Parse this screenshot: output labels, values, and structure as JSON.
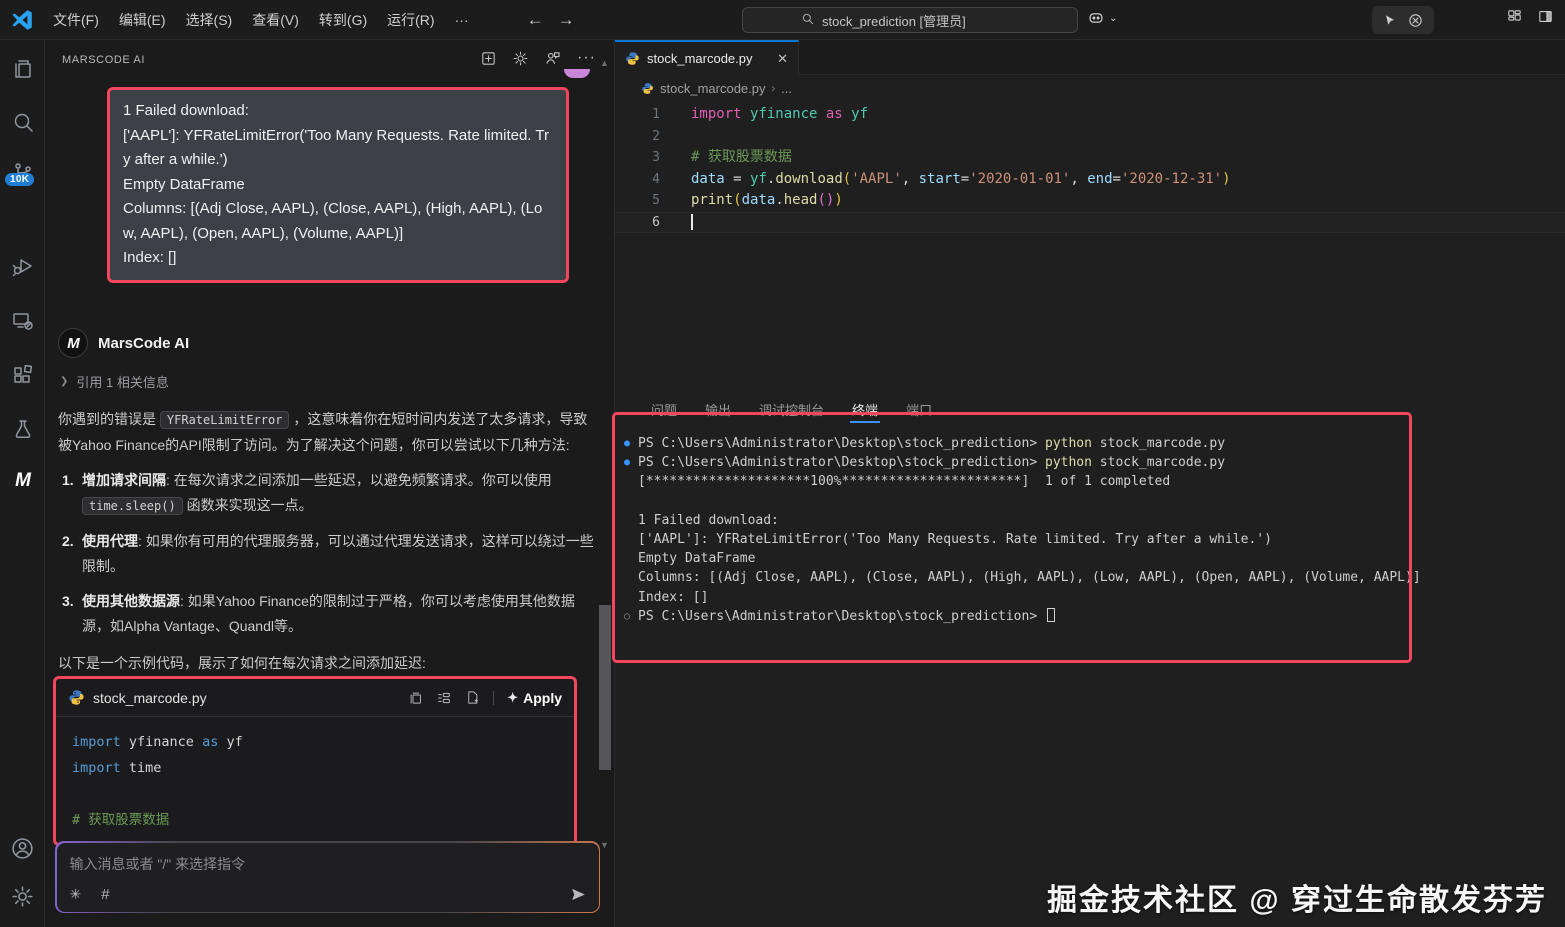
{
  "titlebar": {
    "menus": [
      "文件(F)",
      "编辑(E)",
      "选择(S)",
      "查看(V)",
      "转到(G)",
      "运行(R)"
    ],
    "more": "···",
    "search_text": "stock_prediction [管理员]"
  },
  "activitybar": {
    "scm_badge": "10K",
    "marscode_glyph": "M"
  },
  "sidebar": {
    "title": "MARSCODE AI",
    "tools_more": "···",
    "output_block": {
      "lines": [
        "1 Failed download:",
        "['AAPL']: YFRateLimitError('Too Many Requests. Rate limited. Try after a while.')",
        "Empty DataFrame",
        "Columns: [(Adj Close, AAPL), (Close, AAPL), (High, AAPL), (Low, AAPL), (Open, AAPL), (Volume, AAPL)]",
        "Index: []"
      ]
    },
    "assistant": {
      "name": "MarsCode AI",
      "logo_glyph": "M",
      "reference": "引用 1 相关信息",
      "para_pre": "你遇到的错误是 ",
      "para_code": "YFRateLimitError",
      "para_post": " ，这意味着你在短时间内发送了太多请求，导致被Yahoo Finance的API限制了访问。为了解决这个问题，你可以尝试以下几种方法:",
      "list": [
        {
          "num": "1.",
          "bold": "增加请求间隔",
          "pre": ": 在每次请求之间添加一些延迟，以避免频繁请求。你可以使用 ",
          "code": "time.sleep()",
          "post": " 函数来实现这一点。"
        },
        {
          "num": "2.",
          "bold": "使用代理",
          "pre": ": 如果你有可用的代理服务器，可以通过代理发送请求，这样可以绕过一些限制。",
          "code": "",
          "post": ""
        },
        {
          "num": "3.",
          "bold": "使用其他数据源",
          "pre": ": 如果Yahoo Finance的限制过于严格，你可以考虑使用其他数据源，如Alpha Vantage、Quandl等。",
          "code": "",
          "post": ""
        }
      ],
      "closing": "以下是一个示例代码，展示了如何在每次请求之间添加延迟:"
    },
    "code_card": {
      "filename": "stock_marcode.py",
      "apply_label": "Apply",
      "sparkle": "✦",
      "lines": [
        [
          {
            "c": "kw2",
            "t": "import "
          },
          {
            "c": "w",
            "t": "yfinance "
          },
          {
            "c": "kw2",
            "t": "as "
          },
          {
            "c": "w",
            "t": "yf"
          }
        ],
        [
          {
            "c": "kw2",
            "t": "import "
          },
          {
            "c": "w",
            "t": "time"
          }
        ],
        [],
        [
          {
            "c": "cm",
            "t": "# 获取股票数据"
          }
        ]
      ]
    },
    "chat_input": {
      "placeholder": "输入消息或者 \"/\" 来选择指令",
      "command_glyph": "✳",
      "hash_glyph": "#"
    }
  },
  "editor": {
    "tab_label": "stock_marcode.py",
    "tab_close": "✕",
    "breadcrumb_file": "stock_marcode.py",
    "breadcrumb_sep": "›",
    "breadcrumb_more": "...",
    "lines": [
      {
        "num": "1",
        "active": false,
        "cursor": false,
        "tokens": [
          {
            "c": "kw",
            "t": "import "
          },
          {
            "c": "type",
            "t": "yfinance "
          },
          {
            "c": "kw",
            "t": "as "
          },
          {
            "c": "type",
            "t": "yf"
          }
        ]
      },
      {
        "num": "2",
        "active": false,
        "cursor": false,
        "tokens": []
      },
      {
        "num": "3",
        "active": false,
        "cursor": false,
        "tokens": [
          {
            "c": "cm",
            "t": "# 获取股票数据"
          }
        ]
      },
      {
        "num": "4",
        "active": false,
        "cursor": false,
        "tokens": [
          {
            "c": "var",
            "t": "data "
          },
          {
            "c": "op",
            "t": "= "
          },
          {
            "c": "type",
            "t": "yf"
          },
          {
            "c": "op",
            "t": "."
          },
          {
            "c": "fn",
            "t": "download"
          },
          {
            "c": "b1",
            "t": "("
          },
          {
            "c": "str",
            "t": "'AAPL'"
          },
          {
            "c": "op",
            "t": ", "
          },
          {
            "c": "var",
            "t": "start"
          },
          {
            "c": "op",
            "t": "="
          },
          {
            "c": "str",
            "t": "'2020-01-01'"
          },
          {
            "c": "op",
            "t": ", "
          },
          {
            "c": "var",
            "t": "end"
          },
          {
            "c": "op",
            "t": "="
          },
          {
            "c": "str",
            "t": "'2020-12-31'"
          },
          {
            "c": "b1",
            "t": ")"
          }
        ]
      },
      {
        "num": "5",
        "active": false,
        "cursor": false,
        "tokens": [
          {
            "c": "fn",
            "t": "print"
          },
          {
            "c": "b1",
            "t": "("
          },
          {
            "c": "var",
            "t": "data"
          },
          {
            "c": "op",
            "t": "."
          },
          {
            "c": "fn",
            "t": "head"
          },
          {
            "c": "b2",
            "t": "("
          },
          {
            "c": "b2",
            "t": ")"
          },
          {
            "c": "b1",
            "t": ")"
          }
        ]
      },
      {
        "num": "6",
        "active": true,
        "cursor": true,
        "tokens": []
      }
    ]
  },
  "panel": {
    "tabs": [
      "问题",
      "输出",
      "调试控制台",
      "终端",
      "端口"
    ],
    "active_tab_index": 3,
    "terminal": [
      {
        "bullet": "●",
        "bullet_style": "blue",
        "tokens": [
          {
            "c": "wt",
            "t": "PS C:\\Users\\Administrator\\Desktop\\stock_prediction> "
          },
          {
            "c": "yel",
            "t": "python"
          },
          {
            "c": "wt",
            "t": " stock_marcode.py"
          }
        ]
      },
      {
        "bullet": "●",
        "bullet_style": "blue",
        "tokens": [
          {
            "c": "wt",
            "t": "PS C:\\Users\\Administrator\\Desktop\\stock_prediction> "
          },
          {
            "c": "yel",
            "t": "python"
          },
          {
            "c": "wt",
            "t": " stock_marcode.py"
          }
        ]
      },
      {
        "bullet": "",
        "bullet_style": "",
        "tokens": [
          {
            "c": "wt",
            "t": "[*********************100%***********************]  1 of 1 completed"
          }
        ]
      },
      {
        "bullet": "",
        "bullet_style": "",
        "tokens": []
      },
      {
        "bullet": "",
        "bullet_style": "",
        "tokens": [
          {
            "c": "wt",
            "t": "1 Failed download:"
          }
        ]
      },
      {
        "bullet": "",
        "bullet_style": "",
        "tokens": [
          {
            "c": "wt",
            "t": "['AAPL']: YFRateLimitError('Too Many Requests. Rate limited. Try after a while.')"
          }
        ]
      },
      {
        "bullet": "",
        "bullet_style": "",
        "tokens": [
          {
            "c": "wt",
            "t": "Empty DataFrame"
          }
        ]
      },
      {
        "bullet": "",
        "bullet_style": "",
        "tokens": [
          {
            "c": "wt",
            "t": "Columns: [(Adj Close, AAPL), (Close, AAPL), (High, AAPL), (Low, AAPL), (Open, AAPL), (Volume, AAPL)]"
          }
        ]
      },
      {
        "bullet": "",
        "bullet_style": "",
        "tokens": [
          {
            "c": "wt",
            "t": "Index: []"
          }
        ]
      },
      {
        "bullet": "○",
        "bullet_style": "hollow",
        "tokens": [
          {
            "c": "wt",
            "t": "PS C:\\Users\\Administrator\\Desktop\\stock_prediction> "
          }
        ],
        "cursor": true
      }
    ]
  },
  "watermark": "掘金技术社区 @ 穿过生命散发芬芳",
  "colors": {
    "accent_red": "#f2455e",
    "badge_blue": "#1f7fd6",
    "tab_accent": "#0078d4",
    "terminal_underline": "#3794ff"
  }
}
